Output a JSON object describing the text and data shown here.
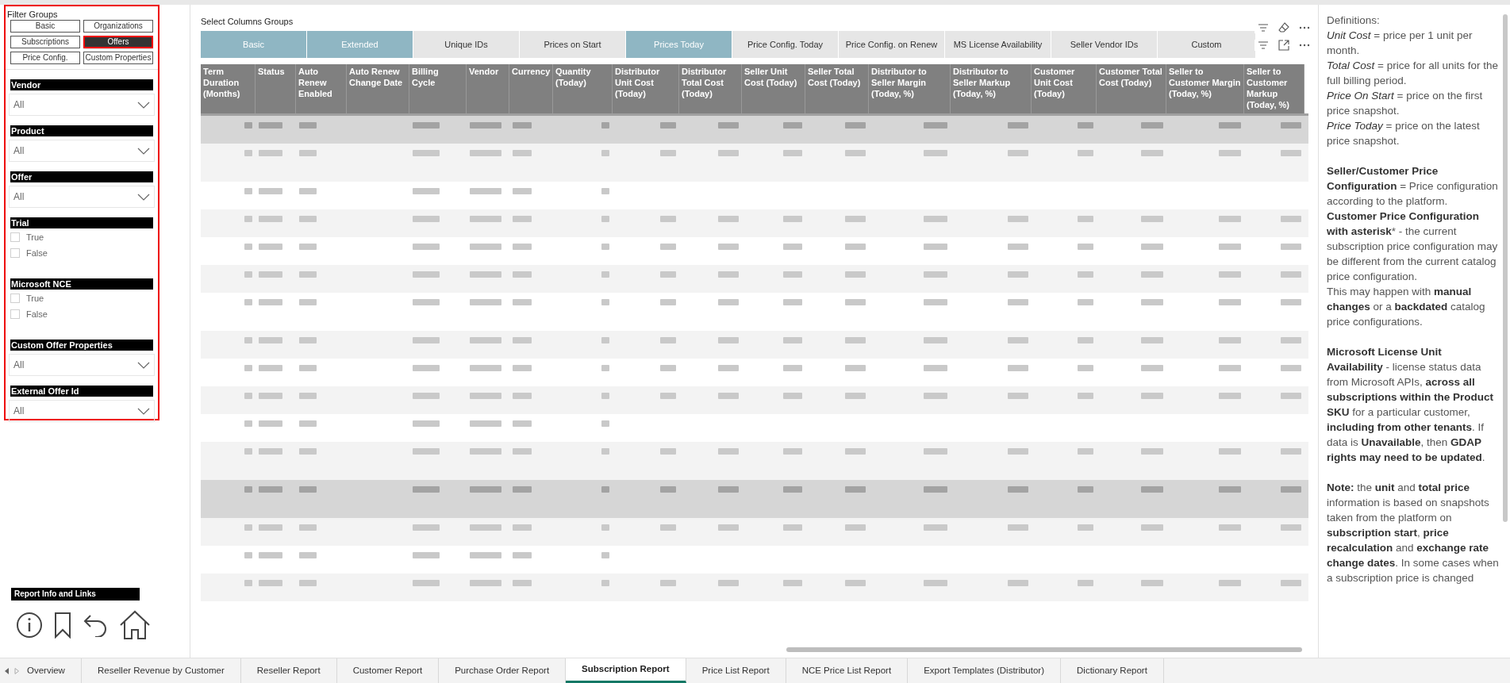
{
  "filter_panel": {
    "title": "Filter Groups",
    "groups": [
      {
        "label": "Basic",
        "selected": false
      },
      {
        "label": "Organizations",
        "selected": false
      },
      {
        "label": "Subscriptions",
        "selected": false
      },
      {
        "label": "Offers",
        "selected": true
      },
      {
        "label": "Price Config.",
        "selected": false
      },
      {
        "label": "Custom Properties",
        "selected": false
      }
    ],
    "filters": [
      {
        "kind": "dropdown",
        "title": "Vendor",
        "value": "All"
      },
      {
        "kind": "dropdown",
        "title": "Product",
        "value": "All"
      },
      {
        "kind": "dropdown",
        "title": "Offer",
        "value": "All"
      },
      {
        "kind": "checkboxes",
        "title": "Trial",
        "options": [
          {
            "label": "True",
            "checked": false
          },
          {
            "label": "False",
            "checked": false
          }
        ]
      },
      {
        "kind": "checkboxes",
        "title": "Microsoft NCE",
        "options": [
          {
            "label": "True",
            "checked": false
          },
          {
            "label": "False",
            "checked": false
          }
        ]
      },
      {
        "kind": "dropdown",
        "title": "Custom Offer Properties",
        "value": "All"
      },
      {
        "kind": "dropdown",
        "title": "External Offer Id",
        "value": "All"
      }
    ]
  },
  "report_info": {
    "title": "Report Info and Links"
  },
  "column_groups": {
    "title": "Select Columns Groups",
    "tabs": [
      {
        "label": "Basic",
        "selected": true
      },
      {
        "label": "Extended",
        "selected": true
      },
      {
        "label": "Unique IDs",
        "selected": false
      },
      {
        "label": "Prices on Start",
        "selected": false
      },
      {
        "label": "Prices Today",
        "selected": true
      },
      {
        "label": "Price Config. Today",
        "selected": false
      },
      {
        "label": "Price Config. on Renew",
        "selected": false
      },
      {
        "label": "MS License Availability",
        "selected": false
      },
      {
        "label": "Seller Vendor IDs",
        "selected": false
      },
      {
        "label": "Custom",
        "selected": false
      }
    ]
  },
  "table": {
    "columns": [
      "Term Duration (Months)",
      "Status",
      "Auto Renew Enabled",
      "Auto Renew Change Date",
      "Billing Cycle",
      "Vendor",
      "Currency",
      "Quantity (Today)",
      "Distributor Unit Cost (Today)",
      "Distributor Total Cost (Today)",
      "Seller Unit Cost (Today)",
      "Seller Total Cost (Today)",
      "Distributor to Seller Margin (Today, %)",
      "Distributor to Seller Markup (Today, %)",
      "Customer Unit Cost (Today)",
      "Customer Total Cost (Today)",
      "Seller to Customer Margin (Today, %)",
      "Seller to Customer Markup (Today, %)"
    ],
    "rows": [
      {
        "kind": "priced",
        "tall": false,
        "selected": true
      },
      {
        "kind": "priced",
        "tall": true,
        "selected": false
      },
      {
        "kind": "unpriced",
        "tall": false,
        "selected": false
      },
      {
        "kind": "priced",
        "tall": false,
        "selected": false
      },
      {
        "kind": "priced",
        "tall": false,
        "selected": false
      },
      {
        "kind": "priced",
        "tall": false,
        "selected": false
      },
      {
        "kind": "priced",
        "tall": true,
        "selected": false
      },
      {
        "kind": "priced",
        "tall": false,
        "selected": false
      },
      {
        "kind": "priced",
        "tall": false,
        "selected": false
      },
      {
        "kind": "priced",
        "tall": false,
        "selected": false
      },
      {
        "kind": "unpriced",
        "tall": false,
        "selected": false
      },
      {
        "kind": "priced",
        "tall": true,
        "selected": false
      },
      {
        "kind": "priced",
        "tall": true,
        "selected": true
      },
      {
        "kind": "priced",
        "tall": false,
        "selected": false
      },
      {
        "kind": "unpriced",
        "tall": false,
        "selected": false
      },
      {
        "kind": "priced",
        "tall": false,
        "selected": false
      }
    ]
  },
  "definitions": [
    "Definitions:",
    "*Unit Cost* = price per 1 unit per month.",
    "*Total Cost* = price for all units for the full billing period.",
    "*Price On Start* = price on the first price snapshot.",
    "*Price Today* = price on the latest price snapshot.",
    "**Seller/Customer Price Configuration** = Price configuration according to the platform.",
    "**Customer Price Configuration with asterisk*** - the current subscription price configuration may be different from the current catalog price configuration.",
    "This may happen with **manual changes** or a **backdated** catalog price configurations.",
    "**Microsoft License Unit Availability** - license status data from Microsoft APIs, **across all subscriptions within the Product SKU** for a particular customer, **including from other tenants**. If data is **Unavailable**, then **GDAP rights may need to be updated**.",
    "**Note:** the **unit** and **total price** information is based on snapshots taken from the platform on **subscription start**, **price recalculation** and **exchange rate change dates**. In some cases when a subscription price is changed"
  ],
  "page_tabs": [
    {
      "label": "Overview",
      "selected": false
    },
    {
      "label": "Reseller Revenue by Customer",
      "selected": false
    },
    {
      "label": "Reseller Report",
      "selected": false
    },
    {
      "label": "Customer Report",
      "selected": false
    },
    {
      "label": "Purchase Order Report",
      "selected": false
    },
    {
      "label": "Subscription Report",
      "selected": true
    },
    {
      "label": "Price List Report",
      "selected": false
    },
    {
      "label": "NCE Price List Report",
      "selected": false
    },
    {
      "label": "Export Templates (Distributor)",
      "selected": false
    },
    {
      "label": "Dictionary Report",
      "selected": false
    }
  ]
}
